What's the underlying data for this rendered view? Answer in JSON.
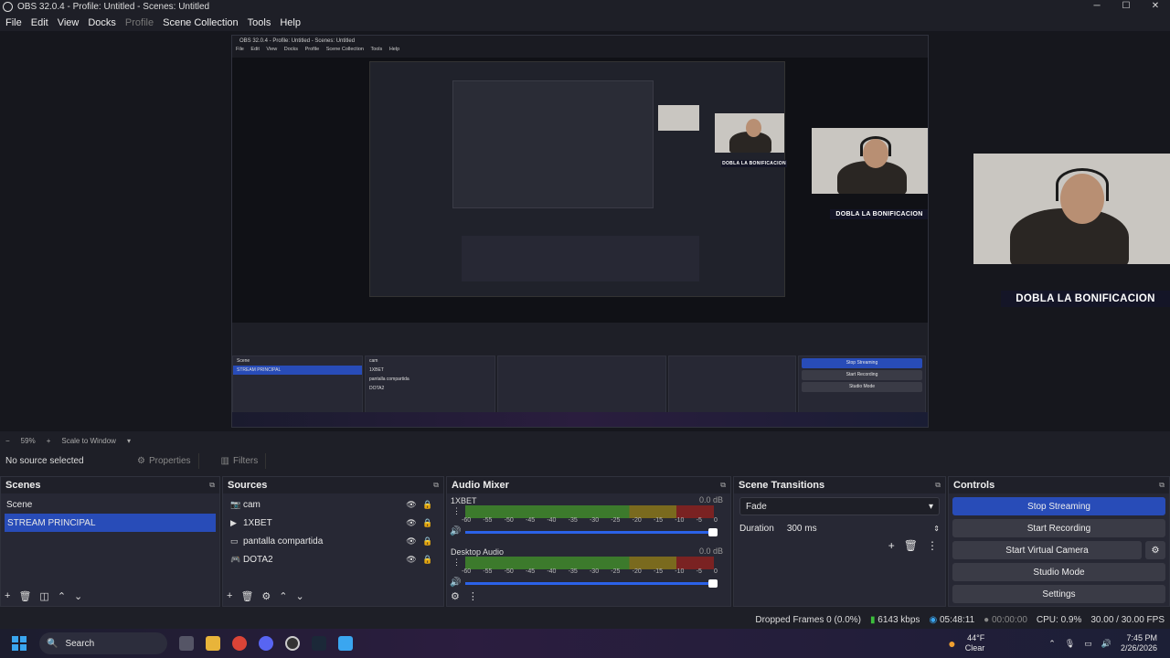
{
  "window": {
    "title": "OBS 32.0.4 - Profile: Untitled - Scenes: Untitled",
    "minimize": "─",
    "maximize": "☐",
    "close": "✕"
  },
  "menu": [
    "File",
    "Edit",
    "View",
    "Docks",
    "Profile",
    "Scene Collection",
    "Tools",
    "Help"
  ],
  "preview": {
    "overlay_text": "DOBLA LA BONIFICACION",
    "nested_title": "OBS 32.0.4 - Profile: Untitled - Scenes: Untitled",
    "nested_menu": [
      "File",
      "Edit",
      "View",
      "Docks",
      "Profile",
      "Scene Collection",
      "Tools",
      "Help"
    ]
  },
  "scale_bar": {
    "minus": "−",
    "zoom": "59%",
    "plus": "+",
    "mode": "Scale to Window"
  },
  "source_bar": {
    "no_source": "No source selected",
    "properties": "Properties",
    "filters": "Filters"
  },
  "scenes": {
    "title": "Scenes",
    "items": [
      "Scene",
      "STREAM PRINCIPAL"
    ]
  },
  "sources": {
    "title": "Sources",
    "items": [
      {
        "icon": "📷",
        "name": "cam"
      },
      {
        "icon": "▶",
        "name": "1XBET"
      },
      {
        "icon": "▭",
        "name": "pantalla compartida"
      },
      {
        "icon": "🎮",
        "name": "DOTA2"
      }
    ]
  },
  "audio_mixer": {
    "title": "Audio Mixer",
    "channels": [
      {
        "name": "1XBET",
        "db": "0.0 dB"
      },
      {
        "name": "Desktop Audio",
        "db": "0.0 dB"
      }
    ],
    "scale": [
      "-60",
      "-55",
      "-50",
      "-45",
      "-40",
      "-35",
      "-30",
      "-25",
      "-20",
      "-15",
      "-10",
      "-5",
      "0"
    ]
  },
  "transitions": {
    "title": "Scene Transitions",
    "selected": "Fade",
    "duration_label": "Duration",
    "duration_value": "300 ms"
  },
  "controls": {
    "title": "Controls",
    "buttons": [
      "Stop Streaming",
      "Start Recording",
      "Start Virtual Camera",
      "Studio Mode",
      "Settings"
    ]
  },
  "status": {
    "dropped": "Dropped Frames 0 (0.0%)",
    "kbps": "6143 kbps",
    "stream_time": "05:48:11",
    "rec_time": "00:00:00",
    "cpu": "CPU: 0.9%",
    "fps": "30.00 / 30.00 FPS"
  },
  "taskbar": {
    "search": "Search",
    "weather_temp": "44°F",
    "weather_desc": "Clear",
    "time": "7:45 PM",
    "date": "2/26/2026"
  },
  "colors": {
    "accent": "#284cb8",
    "bg": "#1e1f27",
    "dock": "#272834"
  }
}
